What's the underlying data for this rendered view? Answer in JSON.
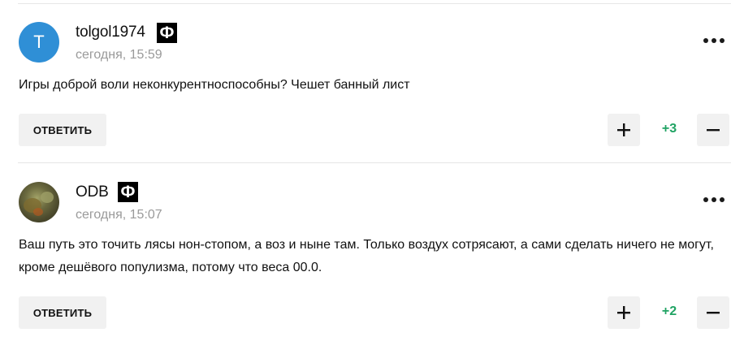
{
  "comments": [
    {
      "avatar_letter": "T",
      "username": "tolgol1974",
      "badge": "Ф",
      "time": "сегодня, 15:59",
      "text": "Игры доброй воли неконкурентноспособны? Чешет банный лист",
      "reply_label": "ОТВЕТИТЬ",
      "score": "+3"
    },
    {
      "avatar_letter": "",
      "username": "ODB",
      "badge": "Ф",
      "time": "сегодня, 15:07",
      "text": "Ваш путь это точить лясы нон-стопом, а воз и ныне там. Только воздух сотрясают, а сами сделать ничего не могут, кроме дешёвого популизма, потому что веса 00.0.",
      "reply_label": "ОТВЕТИТЬ",
      "score": "+2"
    }
  ],
  "icons": {
    "more": "more-dots-icon",
    "plus": "plus-icon",
    "minus": "minus-icon"
  },
  "colors": {
    "score_positive": "#1fa363",
    "avatar_letter_bg": "#2f8fd6",
    "button_bg": "#f1f1f1"
  }
}
